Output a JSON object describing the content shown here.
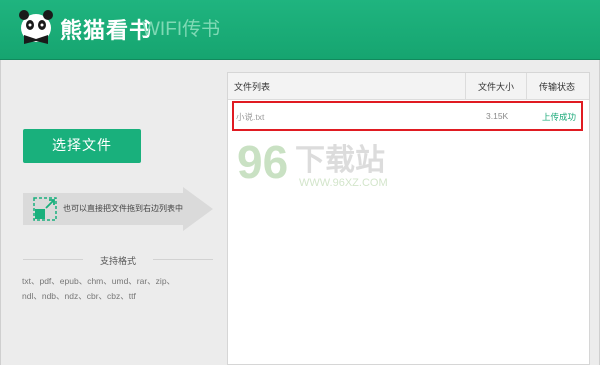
{
  "app": {
    "brand": "熊猫看书",
    "subtitle": "WIFI传书"
  },
  "left": {
    "select_button": "选择文件",
    "drag_hint": "也可以直接把文件拖到右边列表中",
    "formats_title": "支持格式",
    "formats_lines": [
      "txt、pdf、epub、chm、umd、rar、zip、",
      "ndl、ndb、ndz、cbr、cbz、ttf"
    ]
  },
  "file_list": {
    "columns": [
      "文件列表",
      "文件大小",
      "传输状态"
    ],
    "rows": [
      {
        "name": "小说.txt",
        "size": "3.15K",
        "status": "上传成功"
      }
    ]
  },
  "watermark": {
    "number": "96",
    "text": "下载站",
    "url": "WWW.96XZ.COM"
  },
  "colors": {
    "brand_green": "#19b07c",
    "highlight_red": "#e01b22"
  }
}
